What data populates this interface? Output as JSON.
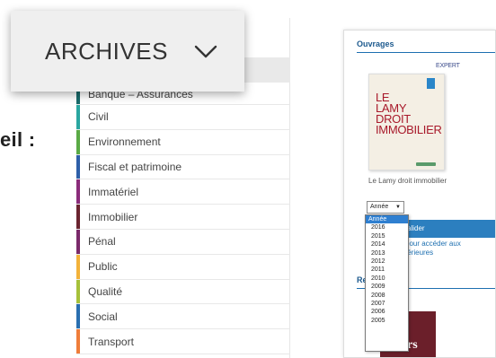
{
  "left_fragment": {
    "text": "eil :"
  },
  "archives_menu": {
    "label": "ARCHIVES",
    "chevron_icon": "chevron-down-icon"
  },
  "categories": [
    {
      "label": "Banque – Assurances",
      "color": "#1a6b6b"
    },
    {
      "label": "Civil",
      "color": "#2aa6a0"
    },
    {
      "label": "Environnement",
      "color": "#5aaa45"
    },
    {
      "label": "Fiscal et patrimoine",
      "color": "#2e5fa8"
    },
    {
      "label": "Immatériel",
      "color": "#8a2c7a"
    },
    {
      "label": "Immobilier",
      "color": "#6a2430"
    },
    {
      "label": "Pénal",
      "color": "#7a2a6a"
    },
    {
      "label": "Public",
      "color": "#f3b23a"
    },
    {
      "label": "Qualité",
      "color": "#a6c13a"
    },
    {
      "label": "Social",
      "color": "#2a6fb0"
    },
    {
      "label": "Transport",
      "color": "#ef7d3a"
    }
  ],
  "ouvrages": {
    "title": "Ouvrages",
    "expert_label": "EXPERT",
    "book": {
      "lines": [
        "LE",
        "LAMY",
        "DROIT",
        "IMMOBILIER"
      ],
      "caption": "Le Lamy droit immobilier"
    },
    "validate_button": "alider",
    "access_text_line1": "pour accéder aux",
    "access_text_line2": "térieures",
    "re_label": "Re",
    "book2_text": "rs"
  },
  "year_select": {
    "selected_value": "Année",
    "options": [
      "Année",
      "2016",
      "2015",
      "2014",
      "2013",
      "2012",
      "2011",
      "2010",
      "2009",
      "2008",
      "2007",
      "2006",
      "2005"
    ],
    "highlighted_index": 0
  }
}
